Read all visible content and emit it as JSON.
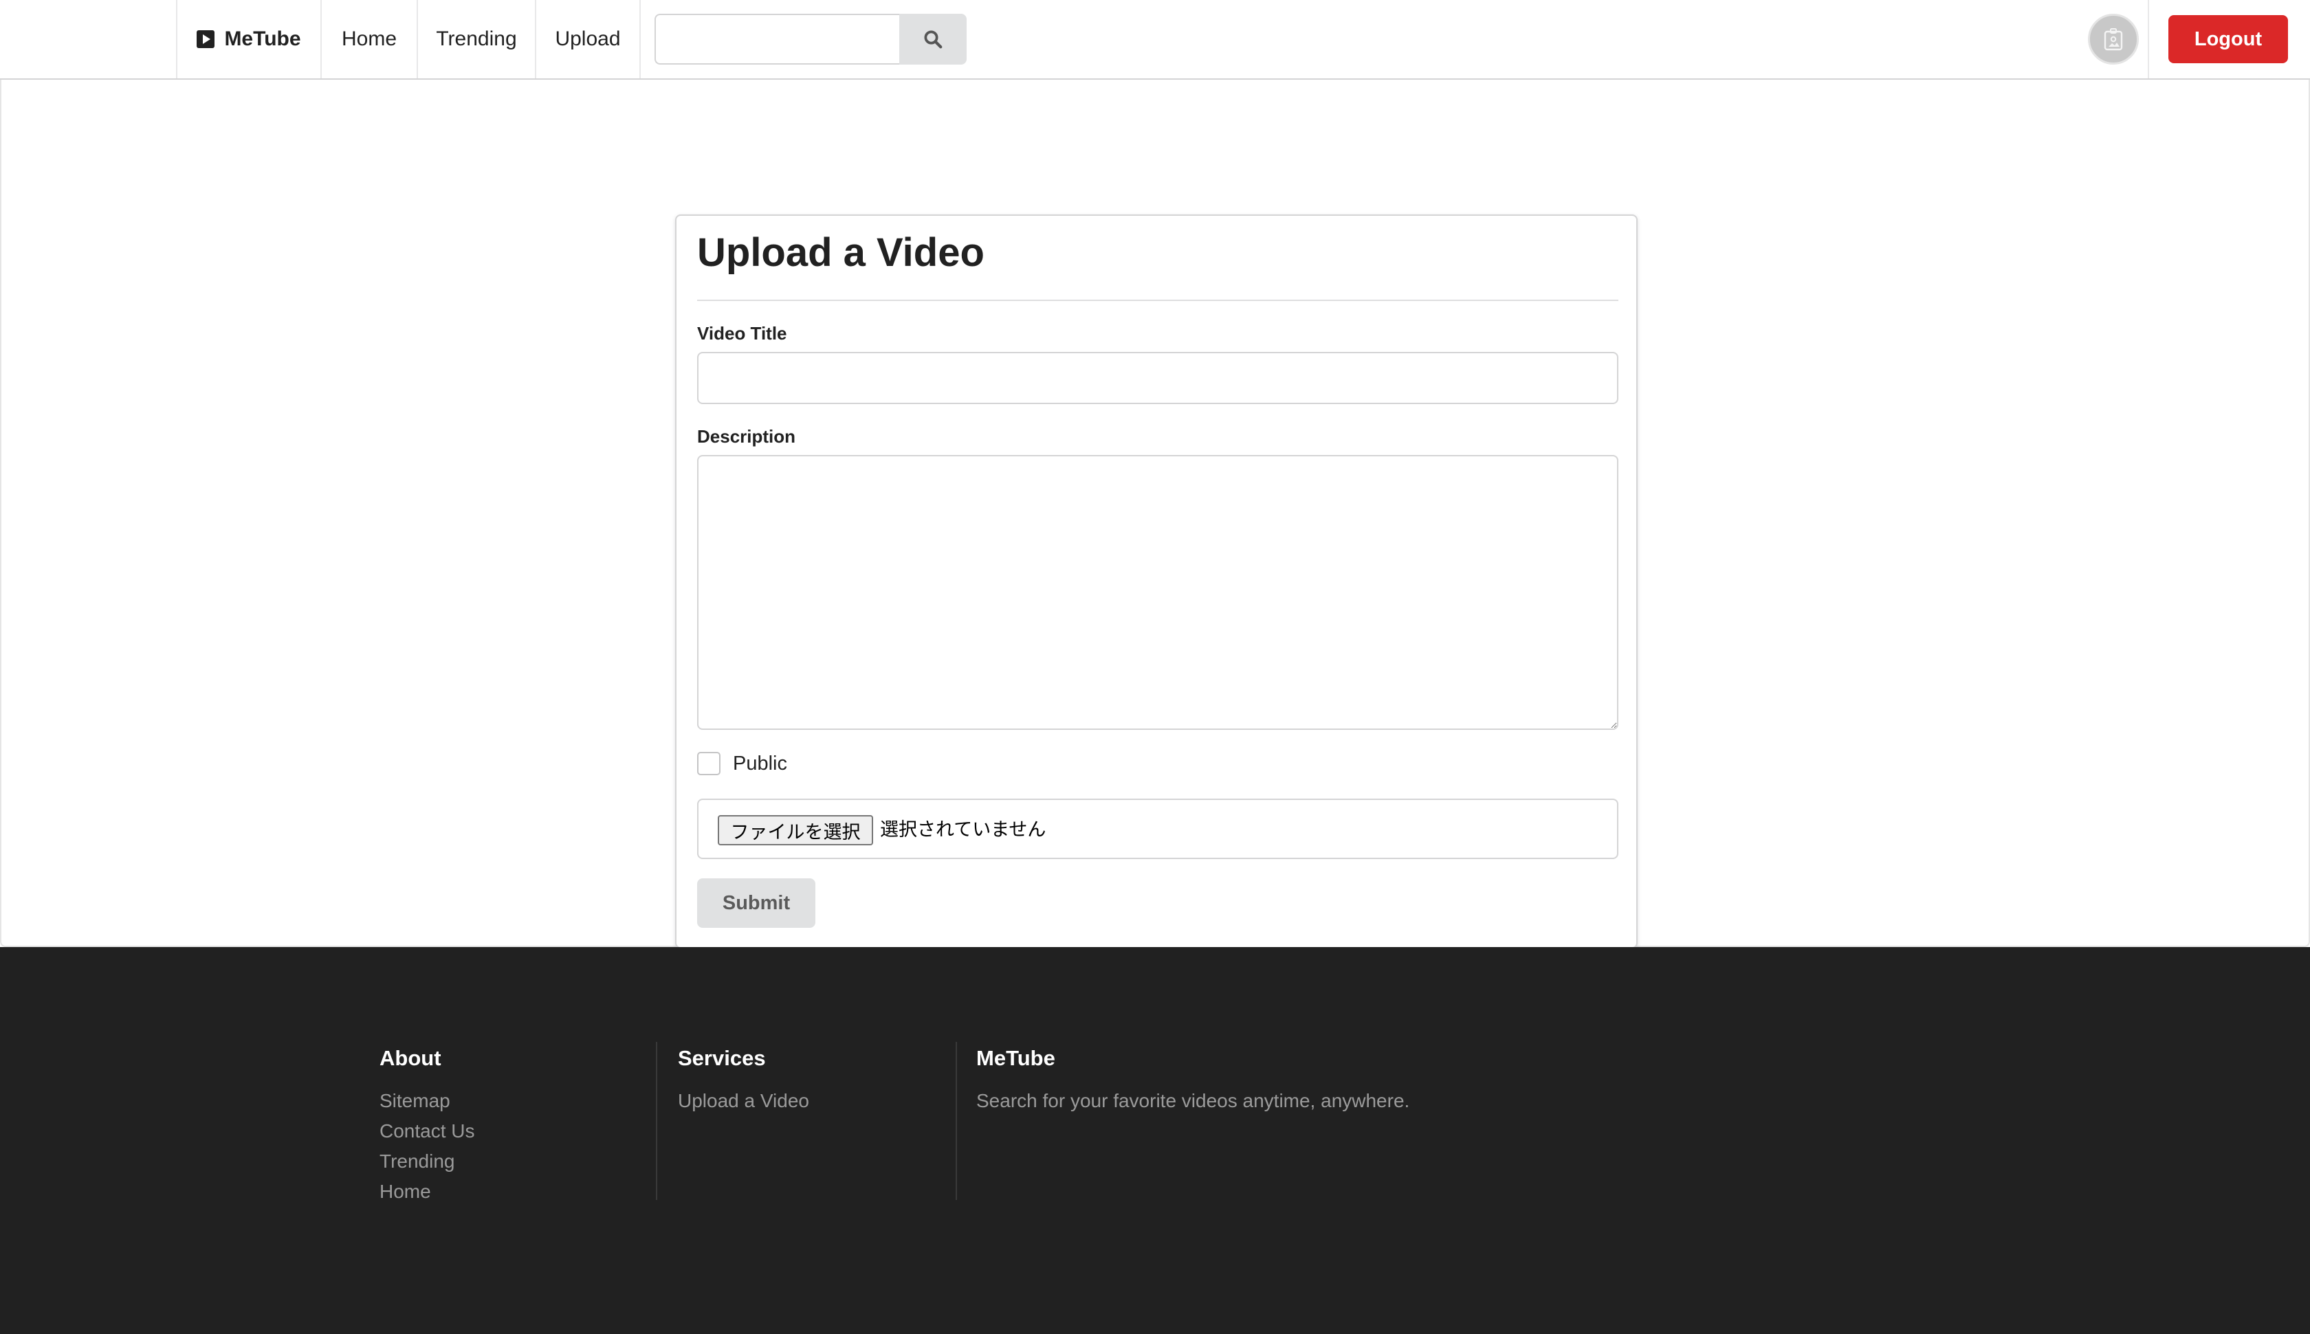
{
  "topbar": {
    "brand": "MeTube",
    "nav": {
      "home": "Home",
      "trending": "Trending",
      "upload": "Upload"
    },
    "search": {
      "value": "",
      "placeholder": ""
    },
    "logout_label": "Logout"
  },
  "form": {
    "heading": "Upload a Video",
    "title_label": "Video Title",
    "title_value": "",
    "description_label": "Description",
    "description_value": "",
    "public_label": "Public",
    "public_checked": false,
    "file_button_label": "ファイルを選択",
    "file_status": "選択されていません",
    "submit_label": "Submit"
  },
  "footer": {
    "about": {
      "heading": "About",
      "links": [
        "Sitemap",
        "Contact Us",
        "Trending",
        "Home"
      ]
    },
    "services": {
      "heading": "Services",
      "links": [
        "Upload a Video"
      ]
    },
    "brand": {
      "heading": "MeTube",
      "text": "Search for your favorite videos anytime, anywhere."
    }
  },
  "colors": {
    "logout": "#db2828",
    "footer_bg": "#212121",
    "button_grey": "#e0e1e2"
  },
  "icons": {
    "brand": "play-square-icon",
    "search": "search-icon",
    "avatar": "user-image-icon"
  }
}
